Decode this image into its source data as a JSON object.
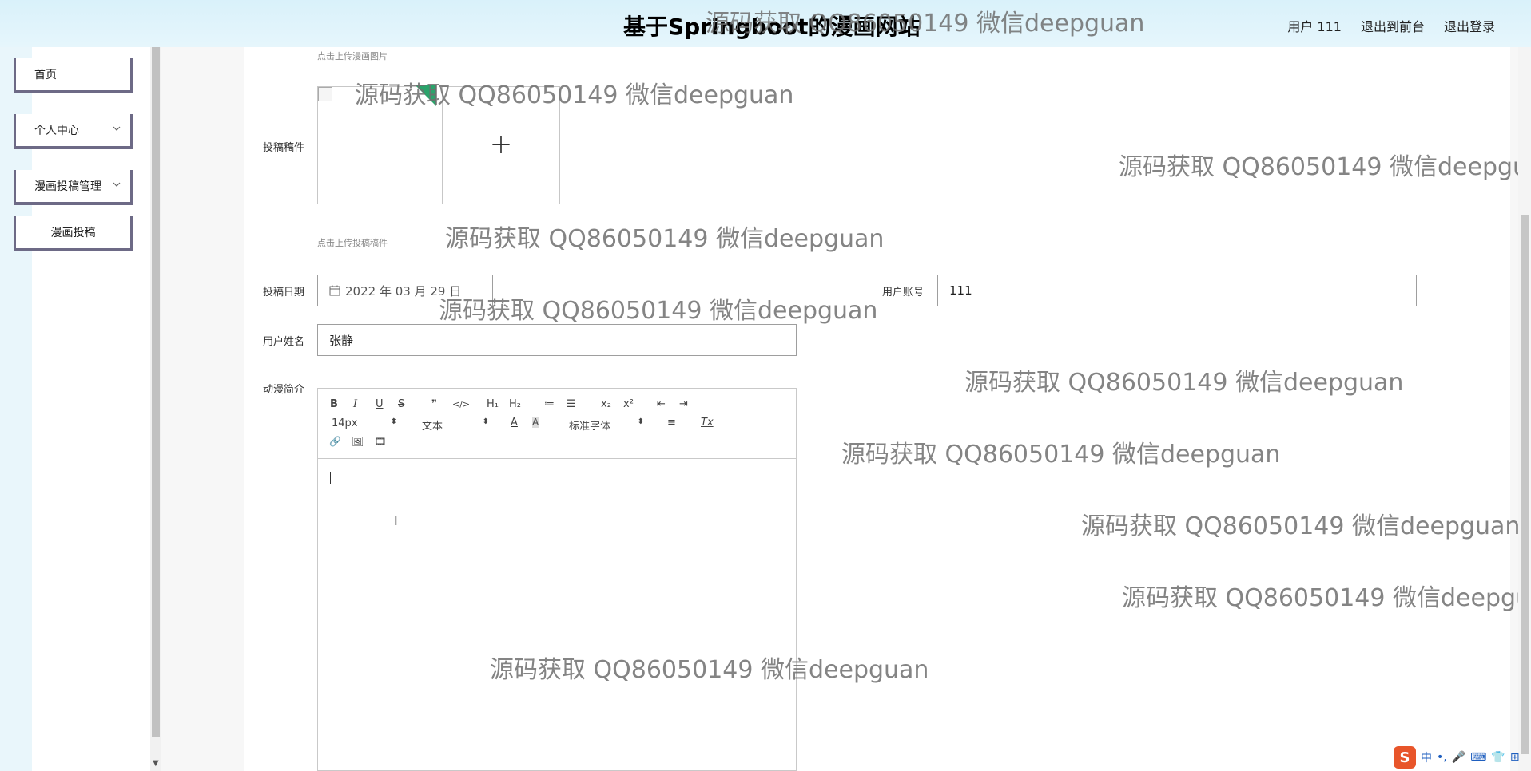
{
  "header": {
    "title": "基于Springboot的漫画网站",
    "links": [
      "用户 111",
      "退出到前台",
      "退出登录"
    ]
  },
  "sidebar": {
    "items": [
      {
        "label": "首页",
        "expandable": false
      },
      {
        "label": "个人中心",
        "expandable": true
      },
      {
        "label": "漫画投稿管理",
        "expandable": true
      },
      {
        "label": "漫画投稿",
        "expandable": false
      }
    ]
  },
  "form": {
    "cover_hint": "点击上传漫画图片",
    "manuscript_label": "投稿稿件",
    "manuscript_hint": "点击上传投稿稿件",
    "upload_plus": "+",
    "date_label": "投稿日期",
    "date_value": "2022 年 03 月 29 日",
    "account_label": "用户账号",
    "account_value": "111",
    "name_label": "用户姓名",
    "name_value": "张静",
    "intro_label": "动漫简介"
  },
  "editor": {
    "row1": [
      "B",
      "I",
      "U",
      "S",
      "❞",
      "</>",
      "H₁",
      "H₂",
      "≔",
      "☰",
      "x₂",
      "x²",
      "⇤",
      "⇥"
    ],
    "size_select": "14px",
    "type_select": "文本",
    "font_select": "标准字体",
    "extras": [
      "A",
      "A",
      "≡",
      "Tx"
    ],
    "row3": [
      "🔗",
      "🖼",
      "🎞"
    ],
    "ibeam": "I"
  },
  "watermark": "源码获取 QQ86050149 微信deepguan",
  "ime": {
    "logo": "S",
    "items": [
      "中",
      "•,",
      "🎤",
      "⌨",
      "👕",
      "⊞"
    ]
  }
}
